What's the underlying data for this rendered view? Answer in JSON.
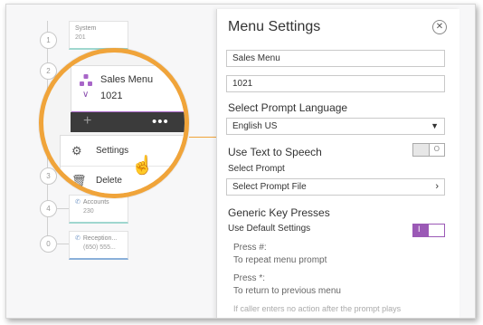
{
  "background_flow": {
    "nodes": [
      "1",
      "2",
      "3",
      "4",
      "0"
    ],
    "top_card": {
      "title": "System",
      "subtitle": "201"
    },
    "accounts_card": {
      "title": "Accounts",
      "subtitle": "230"
    },
    "reception_card": {
      "title": "Reception...",
      "subtitle": "(650) 555..."
    }
  },
  "magnifier": {
    "menu_card_title": "Sales Menu",
    "menu_card_number": "1021",
    "plus_glyph": "+",
    "more_glyph": "•••",
    "context_menu": [
      {
        "label": "Settings",
        "icon": "gear-icon"
      },
      {
        "label": "Delete",
        "icon": "trash-icon"
      }
    ],
    "accent_color": "#f0a43a",
    "card_accent": "#a866c8"
  },
  "panel": {
    "title": "Menu Settings",
    "name_value": "Sales Menu",
    "number_value": "1021",
    "prompt_language_label": "Select Prompt Language",
    "prompt_language_value": "English US",
    "tts_label": "Use Text to Speech",
    "tts_toggle": "O",
    "select_prompt_label": "Select Prompt",
    "select_prompt_value": "Select Prompt File",
    "generic_keys_label": "Generic Key Presses",
    "default_settings_label": "Use Default Settings",
    "default_toggle": "I",
    "press_hash_label": "Press #:",
    "press_hash_desc": "To repeat menu prompt",
    "press_star_label": "Press *:",
    "press_star_desc": "To return to previous menu",
    "no_action_note": "If caller enters no action after the prompt plays",
    "toggle_color": "#9b59b6"
  }
}
